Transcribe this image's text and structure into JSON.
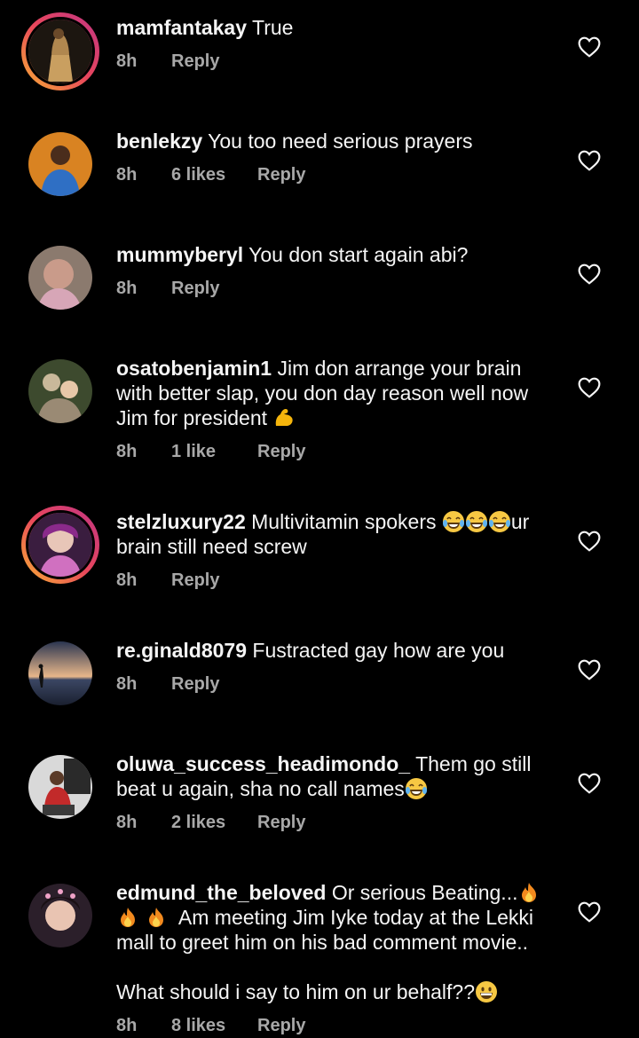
{
  "comments": [
    {
      "username": "mamfantakay",
      "text": "True",
      "time": "8h",
      "likes": "",
      "reply": "Reply"
    },
    {
      "username": "benlekzy",
      "text": "You too need serious prayers",
      "time": "8h",
      "likes": "6 likes",
      "reply": "Reply"
    },
    {
      "username": "mummyberyl",
      "text": "You don start again abi?",
      "time": "8h",
      "likes": "",
      "reply": "Reply"
    },
    {
      "username": "osatobenjamin1",
      "text": "Jim don arrange your brain with better slap, you don day reason well now Jim for president",
      "time": "8h",
      "likes": "1 like",
      "reply": "Reply"
    },
    {
      "username": "stelzluxury22",
      "text_a": "Multivitamin spokers",
      "text_b": "ur brain still need screw",
      "time": "8h",
      "likes": "",
      "reply": "Reply"
    },
    {
      "username": "re.ginald8079",
      "text": "Fustracted gay how are you",
      "time": "8h",
      "likes": "",
      "reply": "Reply"
    },
    {
      "username": "oluwa_success_headimondo_",
      "text": "Them go still beat u again, sha no call names",
      "time": "8h",
      "likes": "2 likes",
      "reply": "Reply"
    },
    {
      "username": "edmund_the_beloved",
      "text_a": "Or serious Beating...",
      "text_b": "Am meeting Jim Iyke today at the Lekki mall to greet him on his bad comment movie..",
      "text_c": "What should i say to him on ur behalf??",
      "time": "8h",
      "likes": "8 likes",
      "reply": "Reply"
    }
  ],
  "icons": {
    "like": "heart-outline-icon"
  },
  "colors": {
    "background": "#000000",
    "text": "#f5f5f5",
    "meta": "#a8a8a8",
    "story_ring_start": "#f9b233",
    "story_ring_end": "#c13584"
  }
}
